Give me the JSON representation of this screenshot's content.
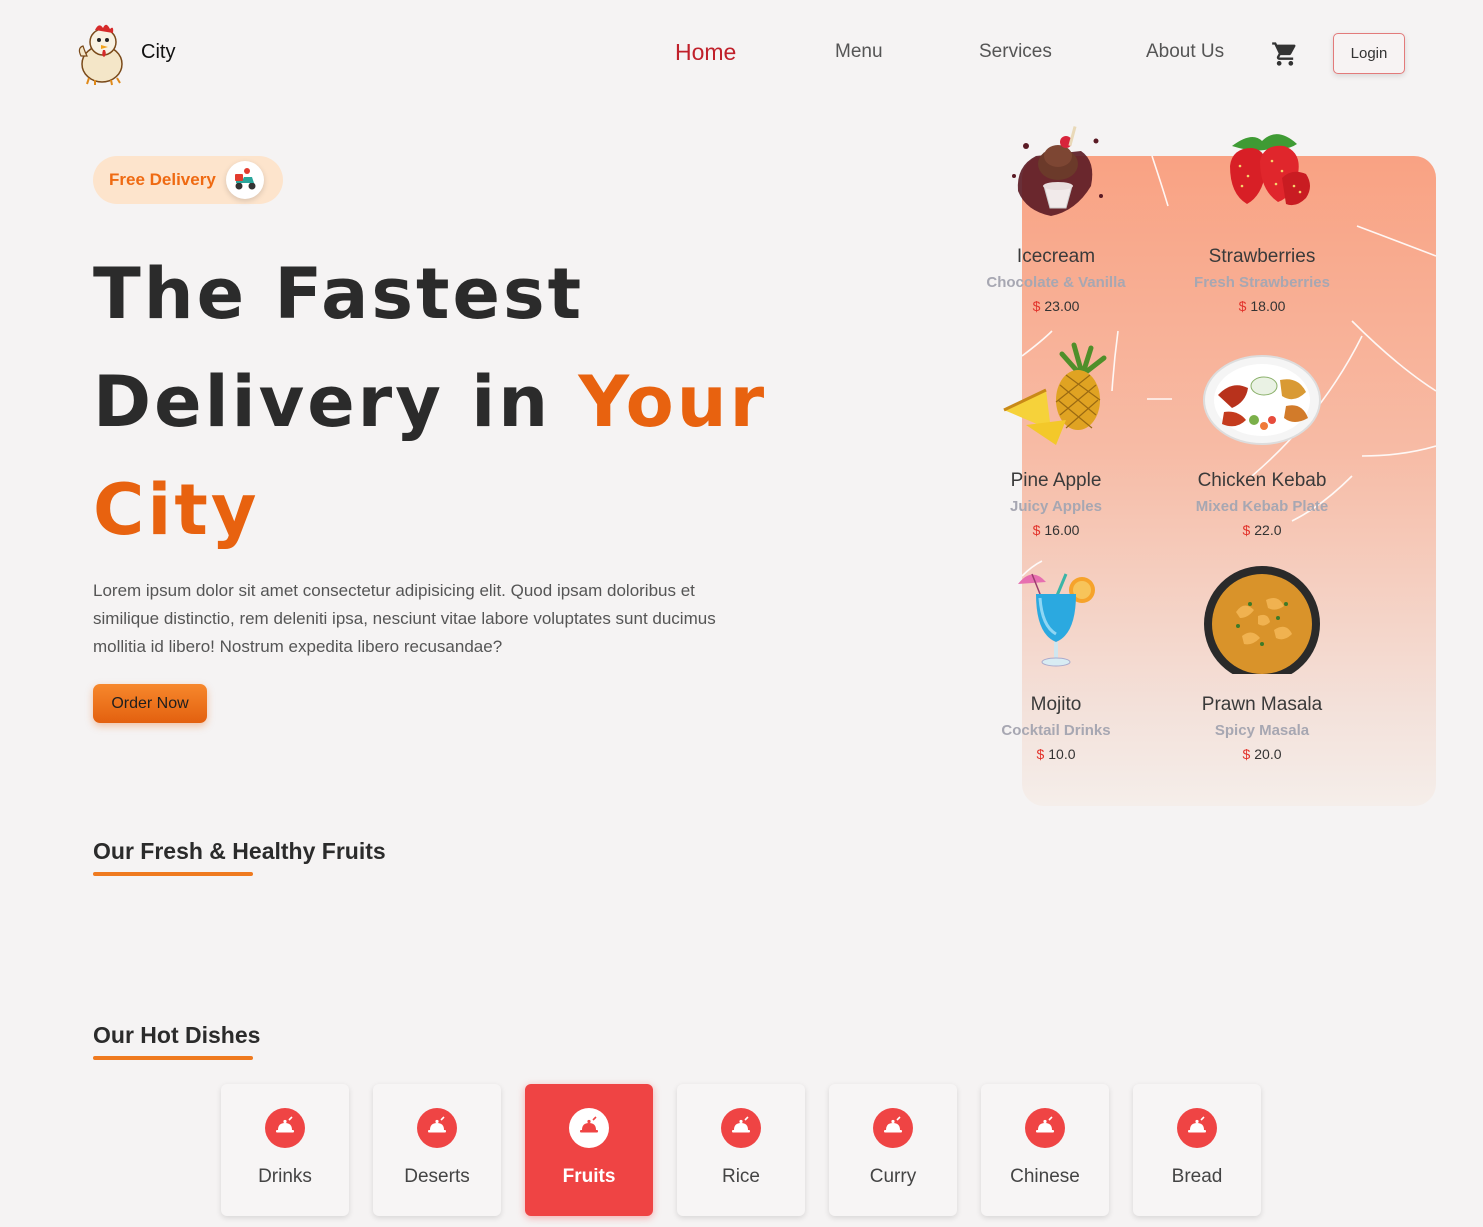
{
  "brand": {
    "name": "City",
    "logo_icon": "rooster-mascot-icon"
  },
  "nav": {
    "items": [
      {
        "label": "Home",
        "active": true
      },
      {
        "label": "Menu",
        "active": false
      },
      {
        "label": "Services",
        "active": false
      },
      {
        "label": "About Us",
        "active": false
      }
    ],
    "cart_icon": "cart-icon",
    "login_label": "Login"
  },
  "hero": {
    "badge_text": "Free Delivery",
    "badge_icon": "delivery-scooter-icon",
    "title_part1": "The Fastest Delivery in",
    "title_accent_1": "Your",
    "title_accent_2": "City",
    "description": "Lorem ipsum dolor sit amet consectetur adipisicing elit. Quod ipsam doloribus et similique distinctio, rem deleniti ipsa, nesciunt vitae labore voluptates sunt ducimus mollitia id libero! Nostrum expedita libero recusandae?",
    "order_button": "Order Now",
    "colors": {
      "accent": "#e8620f",
      "nav_active": "#c0202a"
    }
  },
  "menu_cards": [
    {
      "name": "Icecream",
      "sub": "Chocolate & Vanilla",
      "currency": "$",
      "price": "23.00",
      "icon": "icecream-icon"
    },
    {
      "name": "Strawberries",
      "sub": "Fresh Strawberries",
      "currency": "$",
      "price": "18.00",
      "icon": "strawberry-icon"
    },
    {
      "name": "Pine Apple",
      "sub": "Juicy Apples",
      "currency": "$",
      "price": "16.00",
      "icon": "pineapple-icon"
    },
    {
      "name": "Chicken Kebab",
      "sub": "Mixed Kebab Plate",
      "currency": "$",
      "price": "22.0",
      "icon": "kebab-plate-icon"
    },
    {
      "name": "Mojito",
      "sub": "Cocktail Drinks",
      "currency": "$",
      "price": "10.0",
      "icon": "cocktail-icon"
    },
    {
      "name": "Prawn Masala",
      "sub": "Spicy Masala",
      "currency": "$",
      "price": "20.0",
      "icon": "curry-bowl-icon"
    }
  ],
  "sections": {
    "fruits_title": "Our Fresh & Healthy Fruits",
    "hot_dishes_title": "Our Hot Dishes"
  },
  "categories": [
    {
      "label": "Drinks",
      "active": false,
      "icon": "dish-icon"
    },
    {
      "label": "Deserts",
      "active": false,
      "icon": "dish-icon"
    },
    {
      "label": "Fruits",
      "active": true,
      "icon": "dish-icon"
    },
    {
      "label": "Rice",
      "active": false,
      "icon": "dish-icon"
    },
    {
      "label": "Curry",
      "active": false,
      "icon": "dish-icon"
    },
    {
      "label": "Chinese",
      "active": false,
      "icon": "dish-icon"
    },
    {
      "label": "Bread",
      "active": false,
      "icon": "dish-icon"
    }
  ]
}
